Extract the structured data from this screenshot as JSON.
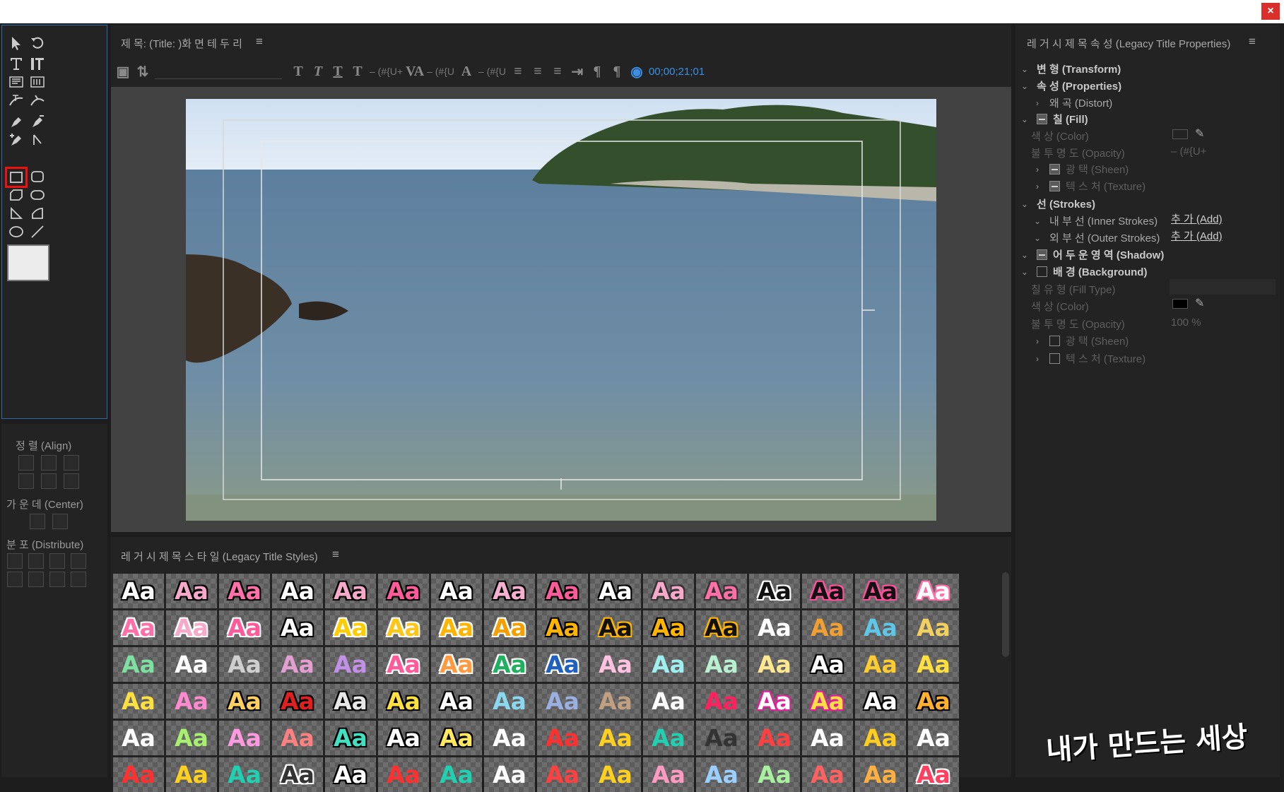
{
  "window": {
    "close_label": "×"
  },
  "title_panel": {
    "header": "제 목:  (Title: )화 면 테 두 리",
    "menu": "≡",
    "timecode": "00;00;21;01",
    "toolbar_items": [
      "– (#{U+",
      "– (#{U",
      "– (#{U"
    ]
  },
  "align_panel": {
    "align_label": "정 렬  (Align)",
    "center_label": "가 운 데  (Center)",
    "distribute_label": "분 포  (Distribute)"
  },
  "styles_panel": {
    "header": "레 거 시  제 목  스 타 일  (Legacy Title Styles)",
    "menu": "≡",
    "swatches": [
      {
        "t": "Aa",
        "c": "#ffffff",
        "s": "#000"
      },
      {
        "t": "Aa",
        "c": "#f6a9c9",
        "s": "#000"
      },
      {
        "t": "Aa",
        "c": "#ff6fa8",
        "s": "#000"
      },
      {
        "t": "Aa",
        "c": "#ffffff",
        "s": "#000"
      },
      {
        "t": "Aa",
        "c": "#f6a9c9",
        "s": "#000"
      },
      {
        "t": "Aa",
        "c": "#ff5a9a",
        "s": "#000"
      },
      {
        "t": "Aa",
        "c": "#ffffff",
        "s": "#000"
      },
      {
        "t": "Aa",
        "c": "#f6b0cf",
        "s": "#000"
      },
      {
        "t": "Aa",
        "c": "#ff5a9a",
        "s": "#000"
      },
      {
        "t": "Aa",
        "c": "#ffffff",
        "s": "#000"
      },
      {
        "t": "Aa",
        "c": "#f6a9c9",
        "s": "#333"
      },
      {
        "t": "Aa",
        "c": "#ff6fa8",
        "s": "#333"
      },
      {
        "t": "Aa",
        "c": "#111111",
        "s": "#fff"
      },
      {
        "t": "Aa",
        "c": "#111111",
        "s": "#ff4f9a"
      },
      {
        "t": "Aa",
        "c": "#111111",
        "s": "#ff4f9a"
      },
      {
        "t": "Aa",
        "c": "#ffffff",
        "s": "#ff6fa8"
      },
      {
        "t": "Aa",
        "c": "#ff6fa8",
        "s": "#fff"
      },
      {
        "t": "Aa",
        "c": "#f6a9c9",
        "s": "#fff"
      },
      {
        "t": "Aa",
        "c": "#ff5a9a",
        "s": "#fff"
      },
      {
        "t": "Aa",
        "c": "#ffffff",
        "s": "#000"
      },
      {
        "t": "Aa",
        "c": "#ffcc00",
        "s": "#fff"
      },
      {
        "t": "Aa",
        "c": "#ffc61a",
        "s": "#fff"
      },
      {
        "t": "Aa",
        "c": "#ffb400",
        "s": "#fff"
      },
      {
        "t": "Aa",
        "c": "#f5a000",
        "s": "#fff"
      },
      {
        "t": "Aa",
        "c": "#ffb400",
        "s": "#000"
      },
      {
        "t": "Aa",
        "c": "#111111",
        "s": "#ffb400"
      },
      {
        "t": "Aa",
        "c": "#ffb400",
        "s": "#000"
      },
      {
        "t": "Aa",
        "c": "#111111",
        "s": "#ffb400"
      },
      {
        "t": "Aa",
        "c": "#ffffff",
        "s": "none"
      },
      {
        "t": "Aa",
        "c": "#f0a030",
        "s": "none"
      },
      {
        "t": "Aa",
        "c": "#5ec7e8",
        "s": "none"
      },
      {
        "t": "Aa",
        "c": "#f2d060",
        "s": "none"
      },
      {
        "t": "Aa",
        "c": "#7ee0a0",
        "s": "none"
      },
      {
        "t": "Aa",
        "c": "#ffffff",
        "s": "none"
      },
      {
        "t": "Aa",
        "c": "#cfcfcf",
        "s": "none"
      },
      {
        "t": "Aa",
        "c": "#e39fd0",
        "s": "none"
      },
      {
        "t": "Aa",
        "c": "#c390e8",
        "s": "none"
      },
      {
        "t": "Aa",
        "c": "#ff5a9a",
        "s": "#fff"
      },
      {
        "t": "Aa",
        "c": "#ff9a40",
        "s": "#fff"
      },
      {
        "t": "Aa",
        "c": "#20b060",
        "s": "#fff"
      },
      {
        "t": "Aa",
        "c": "#2060c0",
        "s": "#fff"
      },
      {
        "t": "Aa",
        "c": "#ffc2e0",
        "s": "none"
      },
      {
        "t": "Aa",
        "c": "#9ef0f0",
        "s": "none"
      },
      {
        "t": "Aa",
        "c": "#b8f0d0",
        "s": "none"
      },
      {
        "t": "Aa",
        "c": "#ffe890",
        "s": "none"
      },
      {
        "t": "Aa",
        "c": "#ffffff",
        "s": "#000"
      },
      {
        "t": "Aa",
        "c": "#ffcc30",
        "s": "none"
      },
      {
        "t": "Aa",
        "c": "#ffe040",
        "s": "none"
      },
      {
        "t": "Aa",
        "c": "#ffe040",
        "s": "none"
      },
      {
        "t": "Aa",
        "c": "#ff8ad0",
        "s": "none"
      },
      {
        "t": "Aa",
        "c": "#ffcf60",
        "s": "#000"
      },
      {
        "t": "Aa",
        "c": "#e02020",
        "s": "#000"
      },
      {
        "t": "Aa",
        "c": "#e8e8e8",
        "s": "#000"
      },
      {
        "t": "Aa",
        "c": "#ffe040",
        "s": "#000"
      },
      {
        "t": "Aa",
        "c": "#ffffff",
        "s": "#000"
      },
      {
        "t": "Aa",
        "c": "#8ad8f0",
        "s": "none"
      },
      {
        "t": "Aa",
        "c": "#9ab0e0",
        "s": "none"
      },
      {
        "t": "Aa",
        "c": "#c0a080",
        "s": "none"
      },
      {
        "t": "Aa",
        "c": "#ffffff",
        "s": "none"
      },
      {
        "t": "Aa",
        "c": "#ff2060",
        "s": "none"
      },
      {
        "t": "Aa",
        "c": "#ffffff",
        "s": "#e0209a"
      },
      {
        "t": "Aa",
        "c": "#ffe040",
        "s": "#e0209a"
      },
      {
        "t": "Aa",
        "c": "#ffffff",
        "s": "#000"
      },
      {
        "t": "Aa",
        "c": "#ffb030",
        "s": "#000"
      },
      {
        "t": "Aa",
        "c": "#ffffff",
        "s": "none"
      },
      {
        "t": "Aa",
        "c": "#a8f070",
        "s": "none"
      },
      {
        "t": "Aa",
        "c": "#ff9ae0",
        "s": "none"
      },
      {
        "t": "Aa",
        "c": "#ff8080",
        "s": "none"
      },
      {
        "t": "Aa",
        "c": "#40e0c0",
        "s": "#000"
      },
      {
        "t": "Aa",
        "c": "#ffffff",
        "s": "#000"
      },
      {
        "t": "Aa",
        "c": "#ffe860",
        "s": "#000"
      },
      {
        "t": "Aa",
        "c": "#ffffff",
        "s": "none"
      },
      {
        "t": "Aa",
        "c": "#ff3030",
        "s": "none"
      },
      {
        "t": "Aa",
        "c": "#ffd020",
        "s": "none"
      },
      {
        "t": "Aa",
        "c": "#20d0b0",
        "s": "none"
      },
      {
        "t": "Aa",
        "c": "#333333",
        "s": "none"
      },
      {
        "t": "Aa",
        "c": "#ff4040",
        "s": "none"
      },
      {
        "t": "Aa",
        "c": "#ffffff",
        "s": "none"
      },
      {
        "t": "Aa",
        "c": "#ffcc20",
        "s": "none"
      },
      {
        "t": "Aa",
        "c": "#ffffff",
        "s": "none"
      },
      {
        "t": "Aa",
        "c": "#ff3030",
        "s": "none"
      },
      {
        "t": "Aa",
        "c": "#ffd020",
        "s": "none"
      },
      {
        "t": "Aa",
        "c": "#20d0b0",
        "s": "none"
      },
      {
        "t": "Aa",
        "c": "#333333",
        "s": "#fff"
      },
      {
        "t": "Aa",
        "c": "#ffffff",
        "s": "#000"
      },
      {
        "t": "Aa",
        "c": "#ff3030",
        "s": "none"
      },
      {
        "t": "Aa",
        "c": "#20d0b0",
        "s": "none"
      },
      {
        "t": "Aa",
        "c": "#ffffff",
        "s": "none"
      },
      {
        "t": "Aa",
        "c": "#ff4040",
        "s": "none"
      },
      {
        "t": "Aa",
        "c": "#ffd020",
        "s": "none"
      },
      {
        "t": "Aa",
        "c": "#ff9ac0",
        "s": "none"
      },
      {
        "t": "Aa",
        "c": "#9ad0ff",
        "s": "none"
      },
      {
        "t": "Aa",
        "c": "#a8f0a0",
        "s": "none"
      },
      {
        "t": "Aa",
        "c": "#ff6060",
        "s": "none"
      },
      {
        "t": "Aa",
        "c": "#ffb040",
        "s": "none"
      },
      {
        "t": "Aa",
        "c": "#ff4060",
        "s": "#fff"
      }
    ]
  },
  "props": {
    "header": "레 거 시  제 목  속 성  (Legacy Title Properties)",
    "menu": "≡",
    "rows": {
      "transform": "변 형  (Transform)",
      "properties": "속 성  (Properties)",
      "distort": "왜 곡  (Distort)",
      "fill": "칠  (Fill)",
      "fill_color": "색 상  (Color)",
      "fill_opacity": "불 투 명 도  (Opacity)",
      "fill_opacity_val": "– (#{U+",
      "fill_sheen": "광 택  (Sheen)",
      "fill_texture": "텍 스 처  (Texture)",
      "strokes": "선  (Strokes)",
      "inner": "내 부  선  (Inner Strokes)",
      "inner_add": "추 가  (Add)",
      "outer": "외 부  선  (Outer Strokes)",
      "outer_add": "추 가  (Add)",
      "shadow": "어 두 운  영 역  (Shadow)",
      "background": "배 경  (Background)",
      "fill_type": "칠  유 형  (Fill Type)",
      "bg_color": "색 상  (Color)",
      "bg_opacity": "불 투 명 도  (Opacity)",
      "bg_opacity_val": "100  %",
      "bg_sheen": "광 택  (Sheen)",
      "bg_texture": "텍 스 처  (Texture)"
    }
  },
  "watermark": "내가 만드는 세상"
}
